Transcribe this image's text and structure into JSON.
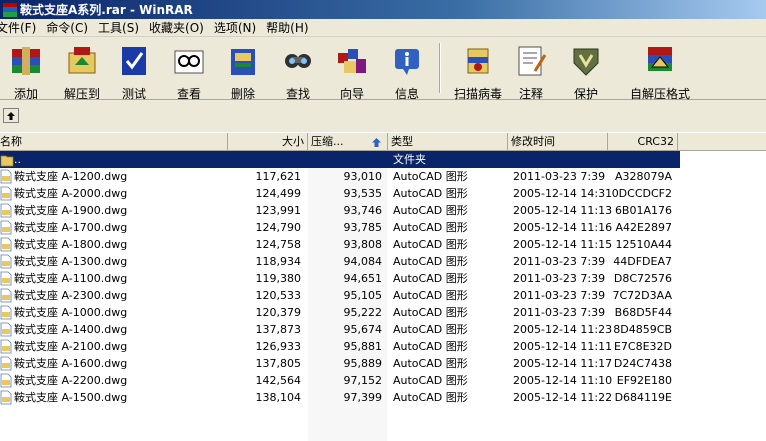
{
  "window": {
    "title": "鞍式支座A系列.rar - WinRAR"
  },
  "menu": [
    "文件(F)",
    "命令(C)",
    "工具(S)",
    "收藏夹(O)",
    "选项(N)",
    "帮助(H)"
  ],
  "toolbar": [
    {
      "label": "添加",
      "icon": "add-archive-icon"
    },
    {
      "label": "解压到",
      "icon": "extract-to-icon"
    },
    {
      "label": "测试",
      "icon": "test-icon"
    },
    {
      "label": "查看",
      "icon": "view-icon"
    },
    {
      "label": "删除",
      "icon": "delete-icon"
    },
    {
      "label": "查找",
      "icon": "find-icon"
    },
    {
      "label": "向导",
      "icon": "wizard-icon"
    },
    {
      "label": "信息",
      "icon": "info-icon"
    },
    {
      "label": "扫描病毒",
      "icon": "virus-scan-icon"
    },
    {
      "label": "注释",
      "icon": "comment-icon"
    },
    {
      "label": "保护",
      "icon": "protect-icon"
    },
    {
      "label": "自解压格式",
      "icon": "sfx-icon"
    }
  ],
  "columns": {
    "name": "名称",
    "size": "大小",
    "packed": "压缩...",
    "type": "类型",
    "modified": "修改时间",
    "crc": "CRC32"
  },
  "parent_row": {
    "name": "..",
    "type": "文件夹"
  },
  "files": [
    {
      "name": "鞍式支座 A-1200.dwg",
      "size": "117,621",
      "packed": "93,010",
      "type": "AutoCAD 图形",
      "modified": "2011-03-23 7:39",
      "crc": "A328079A"
    },
    {
      "name": "鞍式支座 A-2000.dwg",
      "size": "124,499",
      "packed": "93,535",
      "type": "AutoCAD 图形",
      "modified": "2005-12-14 14:31",
      "crc": "0DCCDCF2"
    },
    {
      "name": "鞍式支座 A-1900.dwg",
      "size": "123,991",
      "packed": "93,746",
      "type": "AutoCAD 图形",
      "modified": "2005-12-14 11:13",
      "crc": "6B01A176"
    },
    {
      "name": "鞍式支座 A-1700.dwg",
      "size": "124,790",
      "packed": "93,785",
      "type": "AutoCAD 图形",
      "modified": "2005-12-14 11:16",
      "crc": "A42E2897"
    },
    {
      "name": "鞍式支座 A-1800.dwg",
      "size": "124,758",
      "packed": "93,808",
      "type": "AutoCAD 图形",
      "modified": "2005-12-14 11:15",
      "crc": "12510A44"
    },
    {
      "name": "鞍式支座 A-1300.dwg",
      "size": "118,934",
      "packed": "94,084",
      "type": "AutoCAD 图形",
      "modified": "2011-03-23 7:39",
      "crc": "44DFDEA7"
    },
    {
      "name": "鞍式支座 A-1100.dwg",
      "size": "119,380",
      "packed": "94,651",
      "type": "AutoCAD 图形",
      "modified": "2011-03-23 7:39",
      "crc": "D8C72576"
    },
    {
      "name": "鞍式支座 A-2300.dwg",
      "size": "120,533",
      "packed": "95,105",
      "type": "AutoCAD 图形",
      "modified": "2011-03-23 7:39",
      "crc": "7C72D3AA"
    },
    {
      "name": "鞍式支座 A-1000.dwg",
      "size": "120,379",
      "packed": "95,222",
      "type": "AutoCAD 图形",
      "modified": "2011-03-23 7:39",
      "crc": "B68D5F44"
    },
    {
      "name": "鞍式支座 A-1400.dwg",
      "size": "137,873",
      "packed": "95,674",
      "type": "AutoCAD 图形",
      "modified": "2005-12-14 11:23",
      "crc": "8D4859CB"
    },
    {
      "name": "鞍式支座 A-2100.dwg",
      "size": "126,933",
      "packed": "95,881",
      "type": "AutoCAD 图形",
      "modified": "2005-12-14 11:11",
      "crc": "E7C8E32D"
    },
    {
      "name": "鞍式支座 A-1600.dwg",
      "size": "137,805",
      "packed": "95,889",
      "type": "AutoCAD 图形",
      "modified": "2005-12-14 11:17",
      "crc": "D24C7438"
    },
    {
      "name": "鞍式支座 A-2200.dwg",
      "size": "142,564",
      "packed": "97,152",
      "type": "AutoCAD 图形",
      "modified": "2005-12-14 11:10",
      "crc": "EF92E180"
    },
    {
      "name": "鞍式支座 A-1500.dwg",
      "size": "138,104",
      "packed": "97,399",
      "type": "AutoCAD 图形",
      "modified": "2005-12-14 11:22",
      "crc": "D684119E"
    }
  ]
}
